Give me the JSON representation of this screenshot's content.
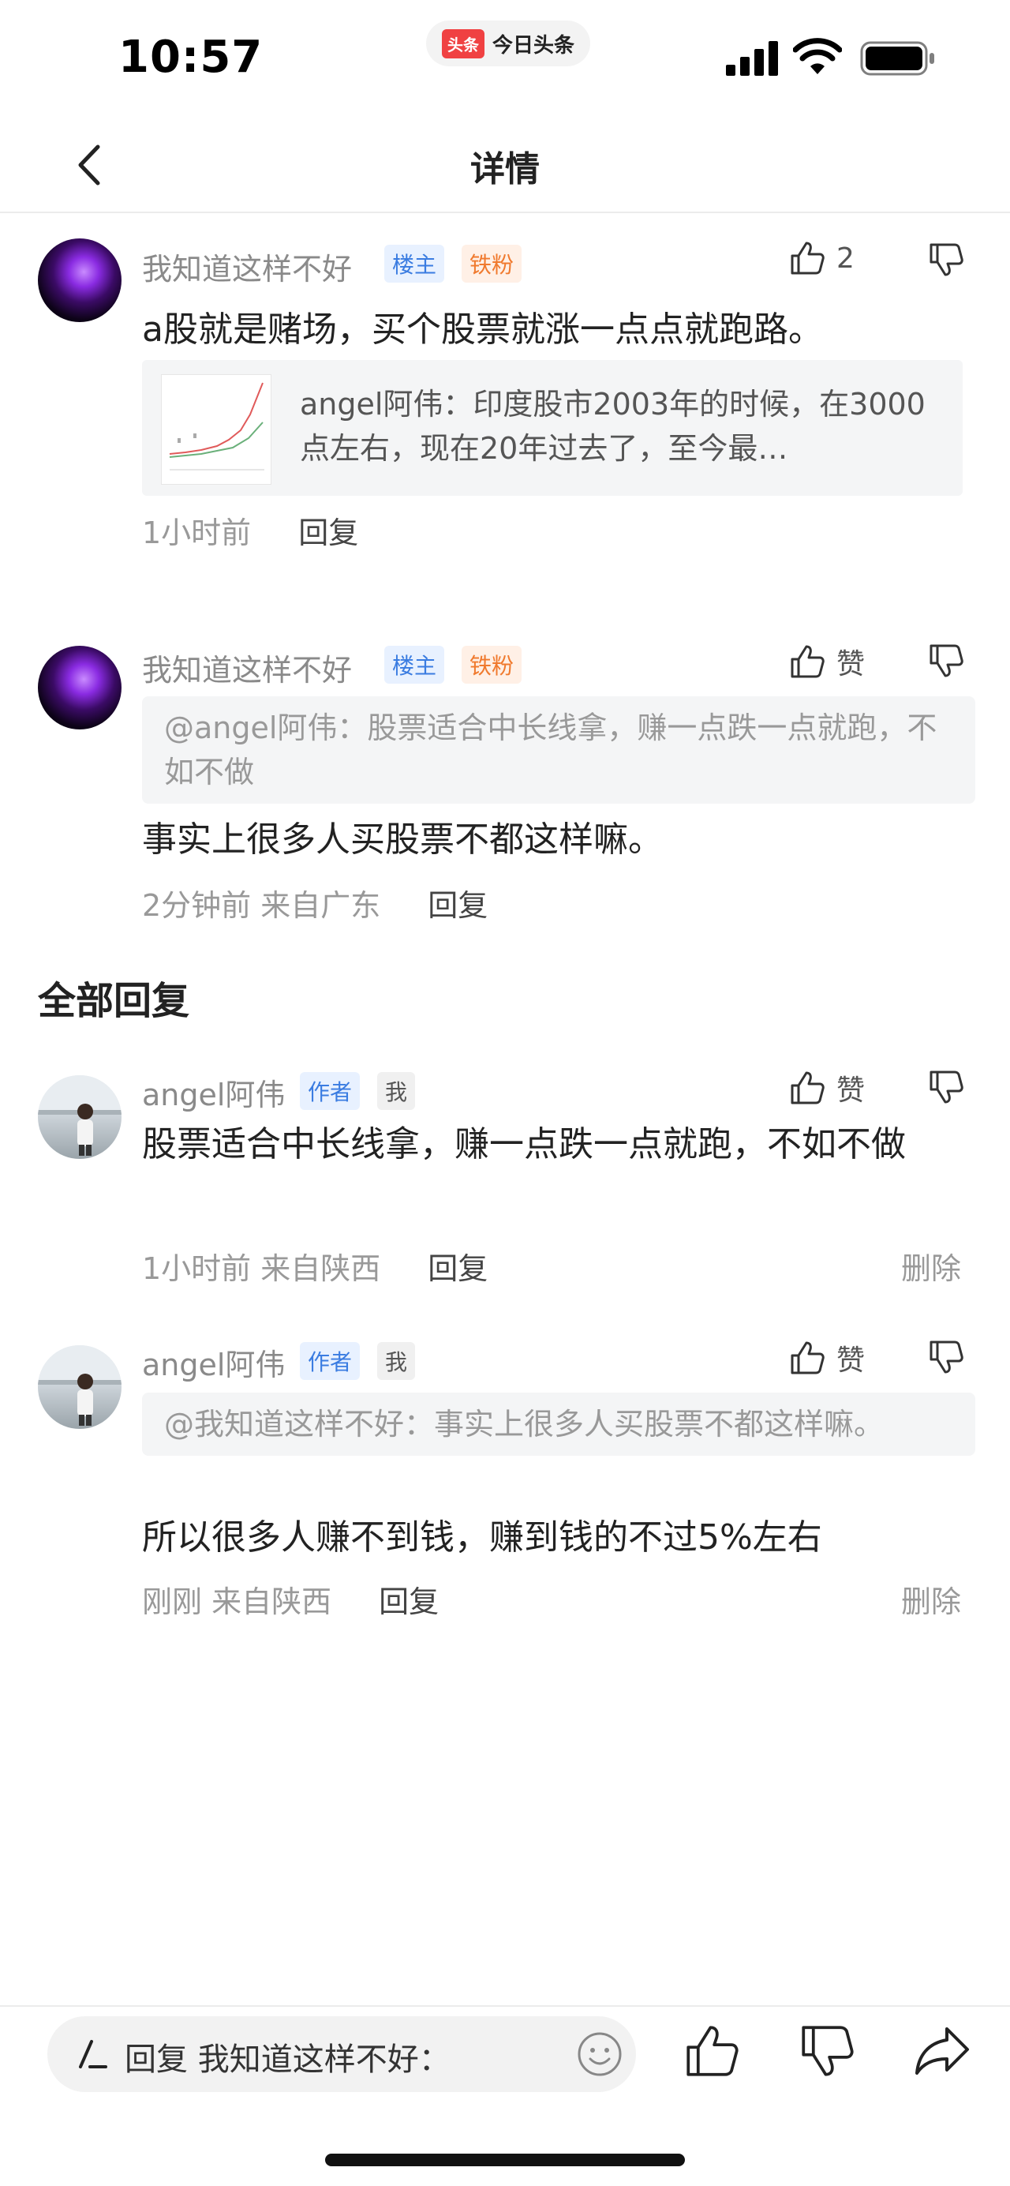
{
  "status": {
    "time": "10:57",
    "app_badge": "头条",
    "app_name": "今日头条"
  },
  "nav": {
    "title": "详情"
  },
  "top_comment": {
    "user": "我知道这样不好",
    "tag1": "楼主",
    "tag2": "铁粉",
    "likes": "2",
    "text": "a股就是赌场，买个股票就涨一点点就跑路。",
    "repost_text": "angel阿伟：印度股市2003年的时候，在3000点左右，现在20年过去了，至今最…",
    "time": "1小时前",
    "reply": "回复"
  },
  "second_comment": {
    "user": "我知道这样不好",
    "tag1": "楼主",
    "tag2": "铁粉",
    "like_label": "赞",
    "quote": "@angel阿伟：股票适合中长线拿，赚一点跌一点就跑，不如不做",
    "text": "事实上很多人买股票不都这样嘛。",
    "time": "2分钟前 来自广东",
    "reply": "回复"
  },
  "section_title": "全部回复",
  "replies": [
    {
      "user": "angel阿伟",
      "tag1": "作者",
      "tag2": "我",
      "like_label": "赞",
      "text": "股票适合中长线拿，赚一点跌一点就跑，不如不做",
      "time": "1小时前 来自陕西",
      "reply": "回复",
      "delete": "删除"
    },
    {
      "user": "angel阿伟",
      "tag1": "作者",
      "tag2": "我",
      "like_label": "赞",
      "quote": "@我知道这样不好：事实上很多人买股票不都这样嘛。",
      "text": "所以很多人赚不到钱，赚到钱的不过5%左右",
      "time": "刚刚 来自陕西",
      "reply": "回复",
      "delete": "删除"
    }
  ],
  "bottom": {
    "placeholder": "回复 我知道这样不好："
  }
}
